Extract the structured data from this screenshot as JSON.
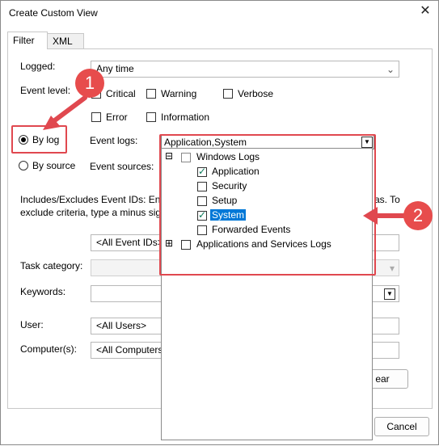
{
  "window": {
    "title": "Create Custom View"
  },
  "tabs": [
    {
      "label": "Filter"
    },
    {
      "label": "XML"
    }
  ],
  "filter": {
    "logged_label": "Logged:",
    "logged_value": "Any time",
    "event_level_label": "Event level:",
    "levels": {
      "critical": "Critical",
      "warning": "Warning",
      "verbose": "Verbose",
      "error": "Error",
      "information": "Information"
    },
    "by_log_label": "By log",
    "by_source_label": "By source",
    "event_logs_label": "Event logs:",
    "event_logs_value": "Application,System",
    "event_sources_label": "Event sources:",
    "includes_text_line1": "Includes/Excludes Event IDs: Ente",
    "includes_text_line1_end": "as. To",
    "includes_text_line2": "exclude criteria, type a minus sig",
    "event_ids_placeholder": "<All Event IDs>",
    "task_category_label": "Task category:",
    "keywords_label": "Keywords:",
    "user_label": "User:",
    "user_value": "<All Users>",
    "computer_label": "Computer(s):",
    "computer_value": "<All Computers",
    "clear_label": "ear",
    "cancel_label": "Cancel"
  },
  "tree": {
    "windows_logs": "Windows Logs",
    "items": [
      {
        "label": "Application",
        "checked": true
      },
      {
        "label": "Security",
        "checked": false
      },
      {
        "label": "Setup",
        "checked": false
      },
      {
        "label": "System",
        "checked": true
      },
      {
        "label": "Forwarded Events",
        "checked": false
      }
    ],
    "apps_services": "Applications and Services Logs"
  },
  "annotations": {
    "badge1": "1",
    "badge2": "2"
  },
  "colors": {
    "annotation_red": "#e0484f",
    "selection_blue": "#0078d7"
  }
}
